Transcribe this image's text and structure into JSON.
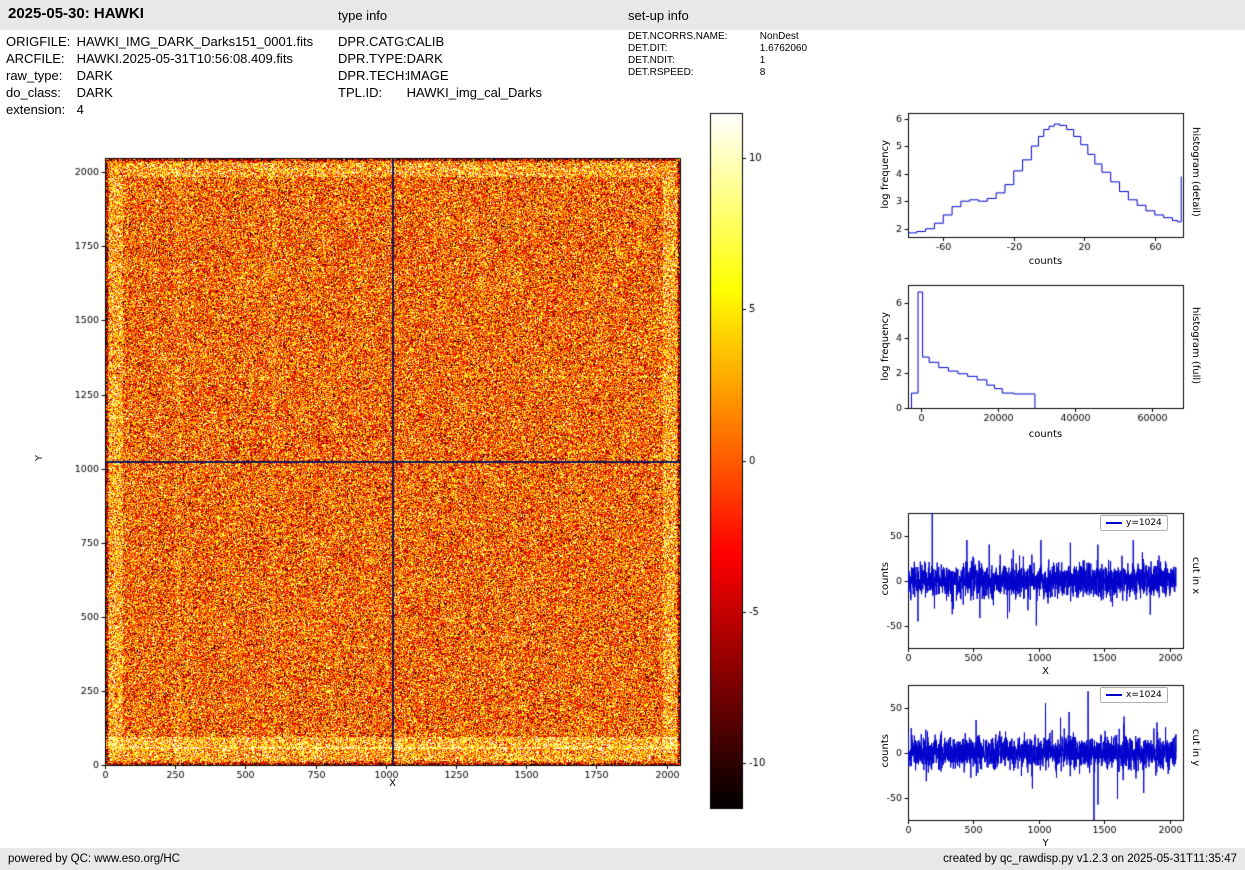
{
  "header": {
    "title": "2025-05-30: HAWKI",
    "type_info_label": "type info",
    "setup_info_label": "set-up info"
  },
  "file_info": {
    "rows": [
      {
        "label": "ORIGFILE:",
        "value": "HAWKI_IMG_DARK_Darks151_0001.fits"
      },
      {
        "label": "ARCFILE:",
        "value": "HAWKI.2025-05-31T10:56:08.409.fits"
      },
      {
        "label": "raw_type:",
        "value": "DARK"
      },
      {
        "label": "do_class:",
        "value": "DARK"
      },
      {
        "label": "extension:",
        "value": "4"
      }
    ]
  },
  "type_info": {
    "rows": [
      {
        "label": "DPR.CATG:",
        "value": "CALIB"
      },
      {
        "label": "DPR.TYPE:",
        "value": "DARK"
      },
      {
        "label": "DPR.TECH:",
        "value": "IMAGE"
      },
      {
        "label": "TPL.ID:",
        "value": "HAWKI_img_cal_Darks"
      }
    ]
  },
  "setup_info": {
    "rows": [
      {
        "label": "DET.NCORRS.NAME:",
        "value": "NonDest"
      },
      {
        "label": "DET.DIT:",
        "value": "1.6762060"
      },
      {
        "label": "DET.NDIT:",
        "value": "1"
      },
      {
        "label": "DET.RSPEED:",
        "value": "8"
      }
    ]
  },
  "footer": {
    "left": "powered by QC: www.eso.org/HC",
    "right": "created by qc_rawdisp.py v1.2.3 on 2025-05-31T11:35:47"
  },
  "chart_data": [
    {
      "id": "main_image",
      "type": "heatmap",
      "description": "HAWKI raw dark frame 2048x2048, speckle noise around 0 counts, hot colormap, bright ring inside detector border, crosshair cut lines at x=1024 and y=1024",
      "xlabel": "X",
      "ylabel": "Y",
      "xlim": [
        0,
        2048
      ],
      "ylim": [
        0,
        2048
      ],
      "xticks": [
        0,
        250,
        500,
        750,
        1000,
        1250,
        1500,
        1750,
        2000
      ],
      "yticks": [
        0,
        250,
        500,
        750,
        1000,
        1250,
        1500,
        1750,
        2000
      ],
      "colormap": "hot",
      "vmin": -11.5,
      "vmax": 11.5,
      "crosshair_x": 1024,
      "crosshair_y": 1024,
      "noise_sigma": 4.2,
      "seed": 7
    },
    {
      "id": "colorbar",
      "type": "colorbar",
      "colormap": "hot",
      "vmin": -11.5,
      "vmax": 11.5,
      "ticks": [
        10,
        5,
        0,
        -5,
        -10
      ]
    },
    {
      "id": "histogram_detail",
      "type": "line",
      "mode": "steps",
      "color": "#0000cc",
      "xlabel": "counts",
      "ylabel": "log frequency",
      "right_label": "histogram (detail)",
      "xlim": [
        -80,
        76
      ],
      "ylim": [
        1.7,
        6.2
      ],
      "xticks": [
        -60,
        -20,
        20,
        60
      ],
      "yticks": [
        2,
        3,
        4,
        5,
        6
      ],
      "x": [
        -80,
        -75,
        -70,
        -65,
        -60,
        -55,
        -50,
        -45,
        -40,
        -35,
        -30,
        -25,
        -20,
        -15,
        -10,
        -6,
        -3,
        0,
        3,
        6,
        10,
        14,
        18,
        22,
        26,
        30,
        35,
        40,
        45,
        50,
        55,
        60,
        65,
        70,
        73,
        75
      ],
      "y": [
        1.85,
        1.9,
        2.0,
        2.2,
        2.5,
        2.8,
        3.0,
        3.05,
        3.0,
        3.1,
        3.3,
        3.6,
        4.1,
        4.5,
        5.0,
        5.35,
        5.6,
        5.72,
        5.8,
        5.75,
        5.6,
        5.35,
        5.05,
        4.7,
        4.35,
        4.05,
        3.7,
        3.35,
        3.05,
        2.85,
        2.65,
        2.5,
        2.4,
        2.3,
        2.25,
        3.9
      ]
    },
    {
      "id": "histogram_full",
      "type": "line",
      "mode": "line",
      "color": "#0000cc",
      "xlabel": "counts",
      "ylabel": "log frequency",
      "right_label": "histogram (full)",
      "xlim": [
        -3500,
        68000
      ],
      "ylim": [
        0,
        7
      ],
      "xticks": [
        0,
        20000,
        40000,
        60000
      ],
      "yticks": [
        0,
        2,
        4,
        6
      ],
      "x": [
        -2600,
        -2600,
        -900,
        -900,
        300,
        300,
        2000,
        2000,
        4500,
        4500,
        7000,
        7000,
        9500,
        9500,
        12000,
        12000,
        14500,
        14500,
        17000,
        17000,
        19000,
        19000,
        21000,
        21000,
        24000,
        24000,
        29500,
        29500
      ],
      "y": [
        0,
        0.85,
        0.85,
        6.6,
        6.6,
        2.9,
        2.9,
        2.6,
        2.6,
        2.3,
        2.3,
        2.1,
        2.1,
        1.95,
        1.95,
        1.8,
        1.8,
        1.6,
        1.6,
        1.3,
        1.3,
        1.1,
        1.1,
        0.85,
        0.85,
        0.8,
        0.8,
        0
      ]
    },
    {
      "id": "cut_x",
      "type": "line",
      "color": "#0000cc",
      "legend": "y=1024",
      "xlabel": "X",
      "ylabel": "counts",
      "right_label": "cut in x",
      "xlim": [
        0,
        2100
      ],
      "ylim": [
        -75,
        75
      ],
      "xticks": [
        0,
        500,
        1000,
        1500,
        2000
      ],
      "yticks": [
        -50,
        0,
        50
      ],
      "n": 2048,
      "noise_sigma": 9,
      "seed": 12,
      "spikes_x": [
        185,
        450,
        620,
        760,
        980,
        1015,
        1240,
        1450,
        1720,
        1850
      ],
      "spikes_y": [
        140,
        45,
        40,
        -42,
        -50,
        45,
        42,
        40,
        45,
        -38
      ]
    },
    {
      "id": "cut_y",
      "type": "line",
      "color": "#0000cc",
      "legend": "x=1024",
      "xlabel": "Y",
      "ylabel": "counts",
      "right_label": "cut in y",
      "xlim": [
        0,
        2100
      ],
      "ylim": [
        -75,
        75
      ],
      "xticks": [
        0,
        500,
        1000,
        1500,
        2000
      ],
      "yticks": [
        -50,
        0,
        50
      ],
      "n": 2048,
      "noise_sigma": 9,
      "seed": 99,
      "spikes_x": [
        140,
        520,
        950,
        1050,
        1230,
        1375,
        1420,
        1650,
        1800
      ],
      "spikes_y": [
        -32,
        36,
        -40,
        55,
        45,
        68,
        -120,
        40,
        -45
      ]
    }
  ]
}
